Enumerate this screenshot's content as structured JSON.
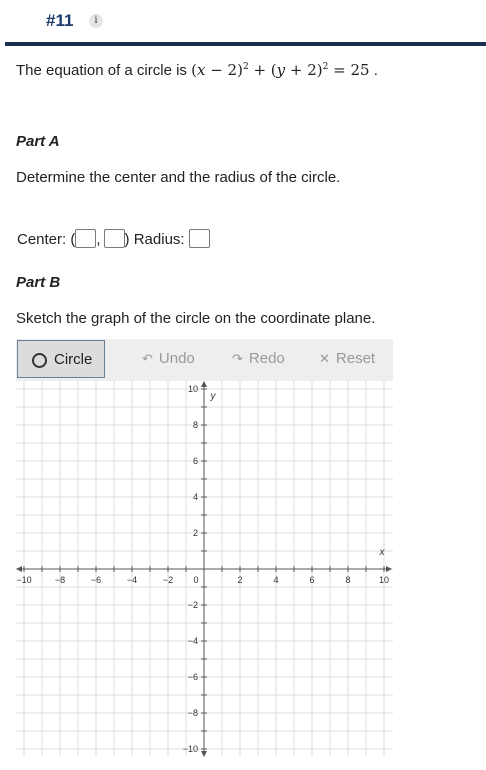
{
  "question": {
    "number": "#11",
    "info_icon": "i"
  },
  "prompt": {
    "intro": "The equation of a circle is",
    "equation": "(x − 2)² + (y + 2)² = 25",
    "end": "."
  },
  "part_a": {
    "title": "Part A",
    "instruction": "Determine the center and the radius of the circle.",
    "center_label": "Center:",
    "open_paren": "(",
    "comma": ",",
    "close_paren": ")",
    "radius_label": "Radius:"
  },
  "part_b": {
    "title": "Part B",
    "instruction": "Sketch the graph of the circle on the coordinate plane."
  },
  "toolbar": {
    "circle": "Circle",
    "undo": "Undo",
    "redo": "Redo",
    "reset": "Reset"
  },
  "graph": {
    "x_label": "x",
    "y_label": "y",
    "x_range": [
      -10,
      10
    ],
    "y_range": [
      -10,
      10
    ],
    "grid_step": 1,
    "label_step": 2
  }
}
